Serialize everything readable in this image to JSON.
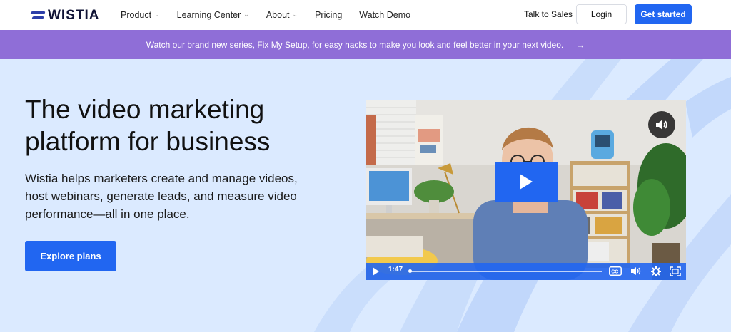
{
  "nav": {
    "logo_text": "WISTIA",
    "links": [
      {
        "label": "Product",
        "has_dropdown": true
      },
      {
        "label": "Learning Center",
        "has_dropdown": true
      },
      {
        "label": "About",
        "has_dropdown": true
      },
      {
        "label": "Pricing",
        "has_dropdown": false
      },
      {
        "label": "Watch Demo",
        "has_dropdown": false
      }
    ],
    "talk_label": "Talk to Sales",
    "login_label": "Login",
    "get_started_label": "Get started"
  },
  "banner": {
    "text": "Watch our brand new series, Fix My Setup, for easy hacks to make you look and feel better in your next video.",
    "arrow": "→"
  },
  "hero": {
    "headline": "The video marketing platform for business",
    "description": "Wistia helps marketers create and manage videos, host webinars, generate leads, and measure video performance—all in one place.",
    "cta_label": "Explore plans"
  },
  "video": {
    "current_time": "1:47",
    "progress": 0.005
  },
  "colors": {
    "brand_blue": "#2166f1",
    "banner_purple": "#8f6ed7",
    "hero_bg": "#dbeaff",
    "logo_navy": "#2c3ea8"
  },
  "icons": [
    "wistia-logo-icon",
    "chevron-down-icon",
    "arrow-right-icon",
    "volume-icon",
    "play-icon",
    "closed-captions-icon",
    "settings-icon",
    "fullscreen-icon"
  ]
}
